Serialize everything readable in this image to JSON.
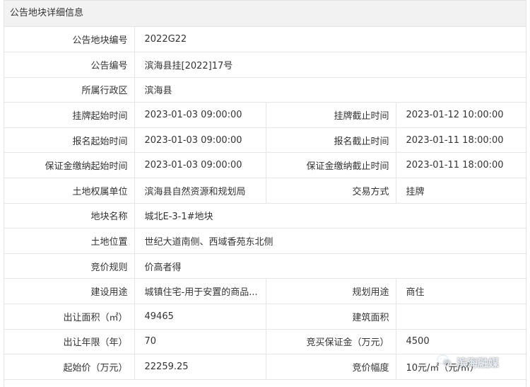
{
  "panel": {
    "title": "公告地块详细信息"
  },
  "rows": [
    {
      "label": "公告地块编号",
      "value": "2022G22"
    },
    {
      "label": "公告编号",
      "value": "滨海县挂[2022]17号"
    },
    {
      "label": "所属行政区",
      "value": "滨海县"
    },
    {
      "label": "挂牌起始时间",
      "value": "2023-01-03 09:00:00",
      "label2": "挂牌截止时间",
      "value2": "2023-01-12 10:00:00"
    },
    {
      "label": "报名起始时间",
      "value": "2023-01-03 09:00:00",
      "label2": "报名截止时间",
      "value2": "2023-01-11 18:00:00"
    },
    {
      "label": "保证金缴纳起始时间",
      "value": "2023-01-03 09:00:00",
      "label2": "保证金缴纳截止时间",
      "value2": "2023-01-11 18:00:00"
    },
    {
      "label": "土地权属单位",
      "value": "滨海县自然资源和规划局",
      "label2": "交易方式",
      "value2": "挂牌"
    },
    {
      "label": "地块名称",
      "value": "城北E-3-1#地块"
    },
    {
      "label": "土地位置",
      "value": "世纪大道南侧、西域香苑东北侧"
    },
    {
      "label": "竞价规则",
      "value": "价高者得"
    },
    {
      "label": "建设用途",
      "value": "城镇住宅-用于安置的商品...",
      "label2": "规划用途",
      "value2": "商住"
    },
    {
      "label": "出让面积（㎡）",
      "value": "49465",
      "label2": "建筑面积",
      "value2": ""
    },
    {
      "label": "出让年限（年）",
      "value": "70",
      "label2": "竞买保证金（万元）",
      "value2": "4500"
    },
    {
      "label": "起始价（万元）",
      "value": "22259.25",
      "label2": "竞价幅度",
      "value2": "10元/㎡（元/㎡）"
    }
  ],
  "watermark": {
    "text": "滨海融媒",
    "icon": "wechat-icon"
  }
}
